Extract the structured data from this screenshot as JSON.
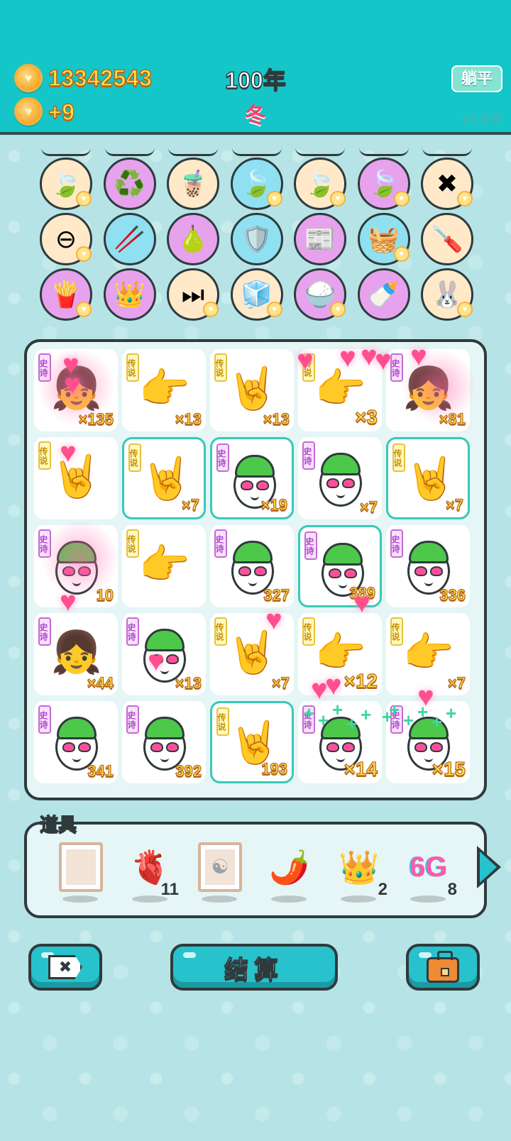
{
  "header": {
    "coins": "13342543",
    "income": "+9",
    "year": "100年",
    "season": "冬",
    "lie_flat_button": "躺平",
    "version": "v1.9.5"
  },
  "relics": [
    {
      "icon": "leaf-icon",
      "glyph": "🍃",
      "bg": "#ffe9c9",
      "badge": true
    },
    {
      "icon": "recycle-icon",
      "glyph": "♻️",
      "bg": "#e7a2ee",
      "badge": false
    },
    {
      "icon": "bubble-tea-icon",
      "glyph": "🧋",
      "bg": "#ffe9c9",
      "badge": false
    },
    {
      "icon": "leaf-icon",
      "glyph": "🍃",
      "bg": "#8fe0f0",
      "badge": true
    },
    {
      "icon": "leaf-icon",
      "glyph": "🍃",
      "bg": "#ffe9c9",
      "badge": true
    },
    {
      "icon": "leaf-icon",
      "glyph": "🍃",
      "bg": "#e7a2ee",
      "badge": true
    },
    {
      "icon": "delete-tag-icon",
      "glyph": "✖",
      "bg": "#ffe9c9",
      "badge": true
    },
    {
      "icon": "minus-circle-icon",
      "glyph": "⊖",
      "bg": "#ffe9c9",
      "badge": true
    },
    {
      "icon": "chopsticks-icon",
      "glyph": "🥢",
      "bg": "#8fe0f0",
      "badge": false
    },
    {
      "icon": "pomelo-icon",
      "glyph": "🍐",
      "bg": "#e7a2ee",
      "badge": false
    },
    {
      "icon": "shield-icon",
      "glyph": "🛡️",
      "bg": "#8fe0f0",
      "badge": false
    },
    {
      "icon": "magazine-icon",
      "glyph": "📰",
      "bg": "#e7a2ee",
      "badge": false
    },
    {
      "icon": "fruit-basket-icon",
      "glyph": "🧺",
      "bg": "#8fe0f0",
      "badge": true
    },
    {
      "icon": "screwdriver-icon",
      "glyph": "🪛",
      "bg": "#ffe9c9",
      "badge": false
    },
    {
      "icon": "fries-icon",
      "glyph": "🍟",
      "bg": "#e7a2ee",
      "badge": true
    },
    {
      "icon": "crown-card-icon",
      "glyph": "👑",
      "bg": "#e7a2ee",
      "badge": false
    },
    {
      "icon": "skip-icon",
      "glyph": "⏭",
      "bg": "#ffe9c9",
      "badge": true
    },
    {
      "icon": "sugar-cubes-icon",
      "glyph": "🧊",
      "bg": "#ffe9c9",
      "badge": true
    },
    {
      "icon": "rice-bowl-icon",
      "glyph": "🍚",
      "bg": "#e7a2ee",
      "badge": true
    },
    {
      "icon": "breast-pump-icon",
      "glyph": "🍼",
      "bg": "#e7a2ee",
      "badge": false
    },
    {
      "icon": "rabbit-icon",
      "glyph": "🐰",
      "bg": "#ffe9c9",
      "badge": true
    }
  ],
  "board": {
    "cells": [
      {
        "tag": "史诗",
        "rarity": "epic",
        "icon": "girl-icon",
        "glyph": "👧",
        "count": "×135",
        "selected": false,
        "big": false
      },
      {
        "tag": "传说",
        "rarity": "legend",
        "icon": "pointing-hand-icon",
        "glyph": "👉",
        "count": "×13",
        "selected": false,
        "big": false
      },
      {
        "tag": "传说",
        "rarity": "legend",
        "icon": "rock-hand-icon",
        "glyph": "🤘",
        "count": "×13",
        "selected": false,
        "big": false
      },
      {
        "tag": "传说",
        "rarity": "legend",
        "icon": "pointing-hand-icon",
        "glyph": "👉",
        "count": "×3",
        "selected": false,
        "big": true
      },
      {
        "tag": "史诗",
        "rarity": "epic",
        "icon": "girl-icon",
        "glyph": "👧",
        "count": "×81",
        "selected": false,
        "big": false
      },
      {
        "tag": "传说",
        "rarity": "legend",
        "icon": "rock-hand-icon",
        "glyph": "🤘",
        "count": "",
        "selected": false,
        "big": false
      },
      {
        "tag": "传说",
        "rarity": "legend",
        "icon": "rock-hand-icon",
        "glyph": "🤘",
        "count": "×7",
        "selected": true,
        "big": false
      },
      {
        "tag": "史诗",
        "rarity": "epic",
        "icon": "green-hair-face-icon",
        "glyph": "face",
        "count": "×19",
        "selected": true,
        "big": false
      },
      {
        "tag": "史诗",
        "rarity": "epic",
        "icon": "green-hair-face-icon",
        "glyph": "face",
        "count": "×7",
        "selected": false,
        "big": false
      },
      {
        "tag": "传说",
        "rarity": "legend",
        "icon": "rock-hand-icon",
        "glyph": "🤘",
        "count": "×7",
        "selected": true,
        "big": false
      },
      {
        "tag": "史诗",
        "rarity": "epic",
        "icon": "heart-face-icon",
        "glyph": "face",
        "count": "10",
        "selected": false,
        "big": false
      },
      {
        "tag": "传说",
        "rarity": "legend",
        "icon": "pointing-hand-icon",
        "glyph": "👉",
        "count": "",
        "selected": false,
        "big": false
      },
      {
        "tag": "史诗",
        "rarity": "epic",
        "icon": "green-hair-face-icon",
        "glyph": "face",
        "count": "327",
        "selected": false,
        "big": false
      },
      {
        "tag": "史诗",
        "rarity": "epic",
        "icon": "green-hair-face-icon",
        "glyph": "face",
        "count": "389",
        "selected": true,
        "big": false
      },
      {
        "tag": "史诗",
        "rarity": "epic",
        "icon": "green-hair-face-icon",
        "glyph": "face",
        "count": "336",
        "selected": false,
        "big": false
      },
      {
        "tag": "史诗",
        "rarity": "epic",
        "icon": "girl-icon",
        "glyph": "👧",
        "count": "×44",
        "selected": false,
        "big": false
      },
      {
        "tag": "史诗",
        "rarity": "epic",
        "icon": "green-hair-face-icon",
        "glyph": "face",
        "count": "×13",
        "selected": false,
        "big": false
      },
      {
        "tag": "传说",
        "rarity": "legend",
        "icon": "rock-hand-icon",
        "glyph": "🤘",
        "count": "×7",
        "selected": false,
        "big": false
      },
      {
        "tag": "传说",
        "rarity": "legend",
        "icon": "pointing-hand-icon",
        "glyph": "👉",
        "count": "×12",
        "selected": false,
        "big": true
      },
      {
        "tag": "传说",
        "rarity": "legend",
        "icon": "pointing-hand-icon",
        "glyph": "👉",
        "count": "×7",
        "selected": false,
        "big": false
      },
      {
        "tag": "史诗",
        "rarity": "epic",
        "icon": "green-hair-face-icon",
        "glyph": "face",
        "count": "341",
        "selected": false,
        "big": false
      },
      {
        "tag": "史诗",
        "rarity": "epic",
        "icon": "green-hair-face-icon",
        "glyph": "face",
        "count": "392",
        "selected": false,
        "big": false
      },
      {
        "tag": "传说",
        "rarity": "legend",
        "icon": "rock-hand-icon",
        "glyph": "🤘",
        "count": "193",
        "selected": true,
        "big": false
      },
      {
        "tag": "史诗",
        "rarity": "epic",
        "icon": "green-hair-face-icon",
        "glyph": "face",
        "count": "×14",
        "selected": false,
        "big": true
      },
      {
        "tag": "史诗",
        "rarity": "epic",
        "icon": "green-hair-face-icon",
        "glyph": "face",
        "count": "×15",
        "selected": false,
        "big": true
      }
    ]
  },
  "items_panel": {
    "label": "道具",
    "items": [
      {
        "icon": "blank-frame-icon",
        "glyph": "frame",
        "qty": ""
      },
      {
        "icon": "liver-icon",
        "glyph": "🫀",
        "qty": "11"
      },
      {
        "icon": "bagua-mirror-icon",
        "glyph": "frame",
        "qty": ""
      },
      {
        "icon": "chili-icon",
        "glyph": "🌶️",
        "qty": ""
      },
      {
        "icon": "crown-icon",
        "glyph": "👑",
        "qty": "2"
      },
      {
        "icon": "6g-icon",
        "glyph": "6G",
        "qty": "8"
      }
    ]
  },
  "bottom": {
    "settle_button": "结算",
    "delete_glyph": "✖"
  },
  "colors": {
    "header_bg": "#14c6c8",
    "body_bg": "#b6e4e6",
    "accent": "#27c2cc",
    "coin_text": "#ffe14a",
    "season": "#ff3d6a"
  }
}
